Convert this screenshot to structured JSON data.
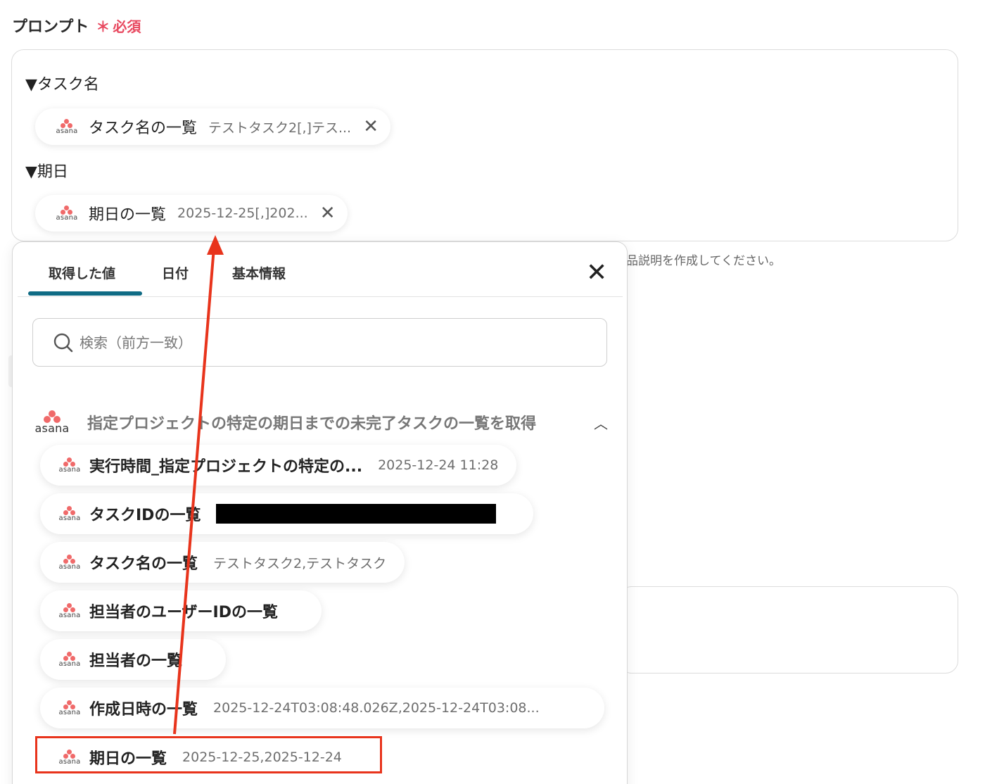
{
  "field": {
    "label": "プロンプト",
    "required_mark": "＊",
    "required_text": "必須"
  },
  "prompt": {
    "section1_title": "▼タスク名",
    "section2_title": "▼期日",
    "chips": [
      {
        "name": "タスク名の一覧",
        "value": "テストタスク2[,]テス...",
        "remove_icon": "close-icon"
      },
      {
        "name": "期日の一覧",
        "value": "2025-12-25[,]202...",
        "remove_icon": "close-icon"
      }
    ]
  },
  "helper_text": "品説明を作成してください。",
  "popup": {
    "tabs": [
      "取得した値",
      "日付",
      "基本情報"
    ],
    "active_tab": "取得した値",
    "search_placeholder": "検索（前方一致）",
    "group": {
      "logo_text": "asana",
      "title": "指定プロジェクトの特定の期日までの未完了タスクの一覧を取得",
      "expanded": true
    },
    "items": [
      {
        "name": "実行時間_指定プロジェクトの特定の...",
        "value": "2025-12-24 11:28"
      },
      {
        "name": "タスクIDの一覧",
        "value": "",
        "redacted": true
      },
      {
        "name": "タスク名の一覧",
        "value": "テストタスク2,テストタスク"
      },
      {
        "name": "担当者のユーザーIDの一覧",
        "value": ""
      },
      {
        "name": "担当者の一覧",
        "value": ""
      },
      {
        "name": "作成日時の一覧",
        "value": "2025-12-24T03:08:48.026Z,2025-12-24T03:08..."
      },
      {
        "name": "期日の一覧",
        "value": "2025-12-25,2025-12-24",
        "highlighted": true
      }
    ]
  },
  "asana_word": "asana",
  "colors": {
    "required": "#e8485f",
    "tab_accent": "#0f6b84",
    "annotation": "#e8341c",
    "asana_dot": "#f06a6a"
  }
}
